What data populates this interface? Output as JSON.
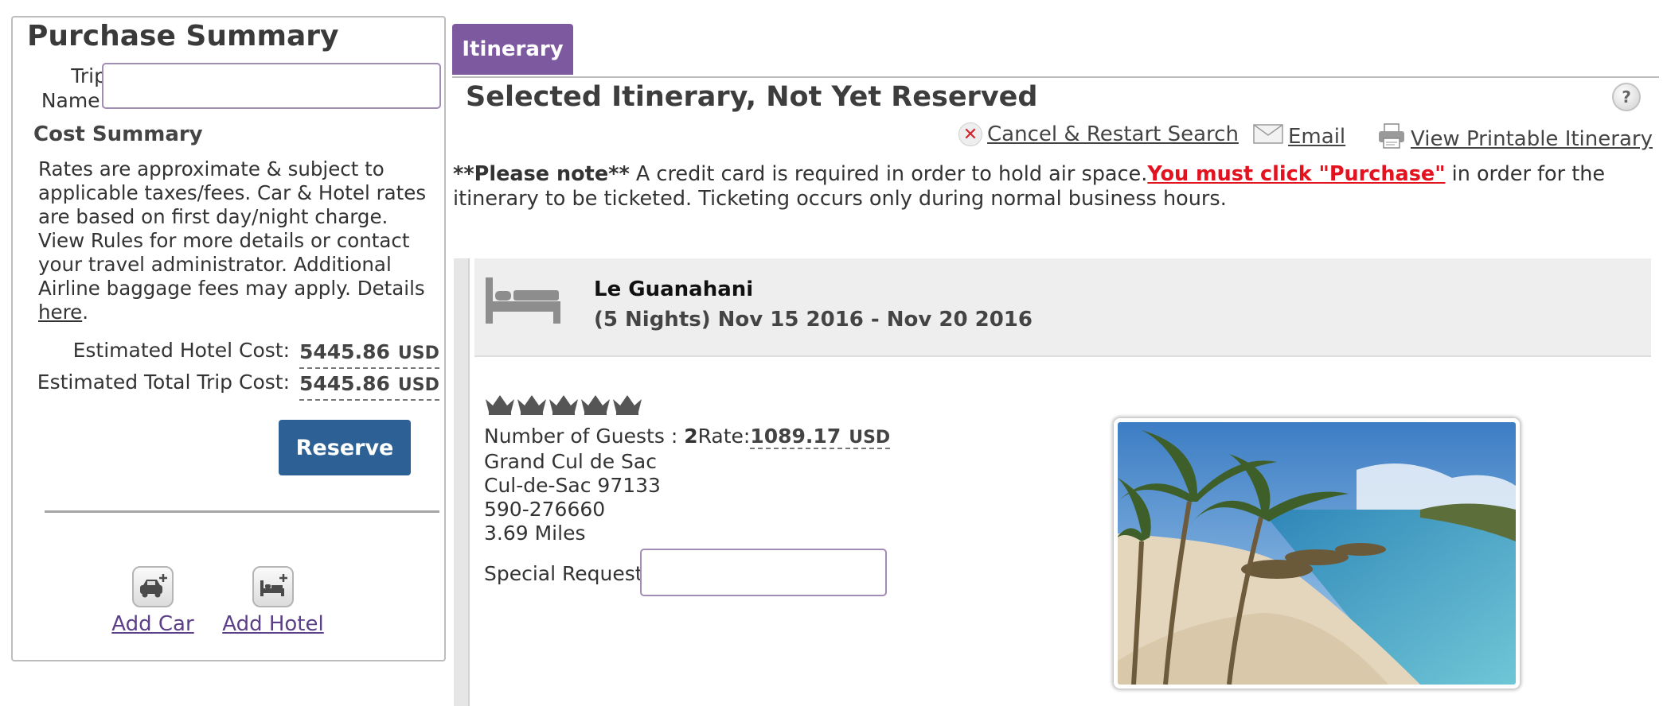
{
  "purchase_summary": {
    "title": "Purchase Summary",
    "trip_name_label": "Trip Name:",
    "trip_name_value": "",
    "cost_summary_title": "Cost Summary",
    "note_text": "Rates are approximate & subject to applicable taxes/fees.  Car & Hotel rates are based on first day/night charge. View Rules for more details or contact your travel administrator. Additional Airline baggage fees may apply. Details ",
    "note_link": "here",
    "note_end": ".",
    "hotel_cost_label": "Estimated Hotel Cost:",
    "hotel_cost_value": "5445.86",
    "hotel_cost_currency": "USD",
    "total_cost_label": "Estimated Total Trip Cost:",
    "total_cost_value": "5445.86",
    "total_cost_currency": "USD",
    "reserve_label": "Reserve",
    "add_car_label": "Add Car",
    "add_hotel_label": "Add Hotel"
  },
  "itinerary": {
    "tab_label": "Itinerary",
    "title": "Selected Itinerary, Not Yet Reserved",
    "help_icon": "?",
    "actions": {
      "cancel_label": "Cancel & Restart Search",
      "email_label": "Email",
      "print_label": "View Printable Itinerary"
    },
    "note": {
      "bold_prefix": "**Please note**",
      "text1": " A credit card is required in order to hold air space.",
      "red_text": "You must click \"Purchase\"",
      "text2": " in order for the itinerary to be ticketed. Ticketing occurs only during normal business hours."
    }
  },
  "hotel": {
    "name": "Le Guanahani",
    "dates": "(5 Nights) Nov 15 2016 - Nov 20 2016",
    "star_count": 5,
    "guests_label": "Number of Guests : ",
    "guests_value": "2",
    "rate_label": "Rate:",
    "rate_value": "1089.17",
    "rate_currency": "USD",
    "address1": "Grand Cul de Sac",
    "address2": "Cul-de-Sac 97133",
    "phone": "590-276660",
    "distance": "3.69 Miles",
    "special_request_label": "Special Request:",
    "special_request_value": ""
  },
  "icons": {
    "bed": "bed-icon",
    "car": "car-plus-icon",
    "hotel": "bed-plus-icon",
    "cancel": "x-icon",
    "email": "envelope-icon",
    "print": "printer-icon",
    "star": "crown-star-icon"
  },
  "colors": {
    "tab": "#7d5aa0",
    "reserve_button": "#2d6094",
    "warning_red": "#e3121f",
    "link_purple": "#5b3f87"
  }
}
